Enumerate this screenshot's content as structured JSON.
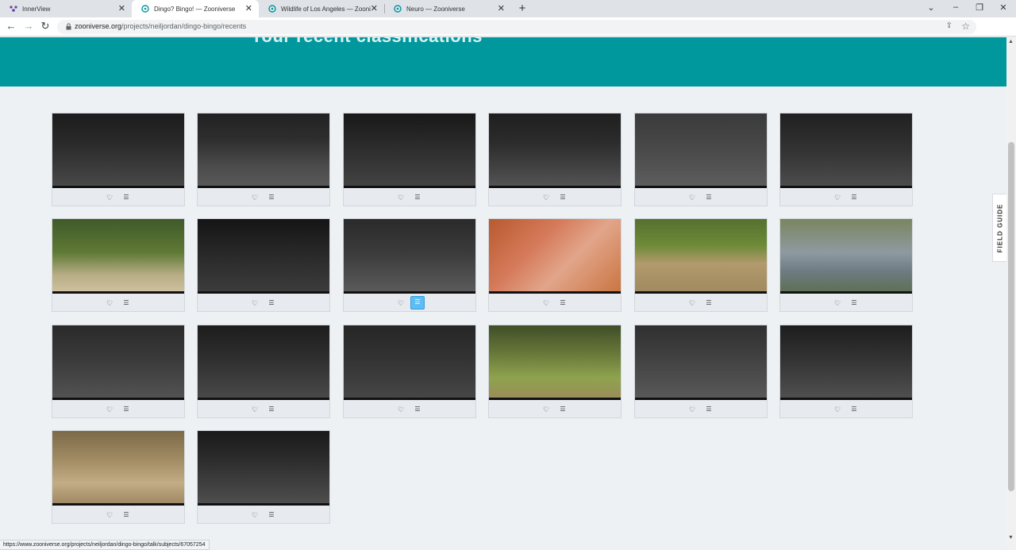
{
  "browser": {
    "tabs": [
      {
        "label": "InnerView",
        "active": false
      },
      {
        "label": "Dingo? Bingo! — Zooniverse",
        "active": true
      },
      {
        "label": "Wildlife of Los Angeles — Zooni",
        "active": false
      },
      {
        "label": "Neuro — Zooniverse",
        "active": false
      }
    ],
    "url_domain": "zooniverse.org",
    "url_path": "/projects/neiljordan/dingo-bingo/recents",
    "status_url": "https://www.zooniverse.org/projects/neiljordan/dingo-bingo/talk/subjects/67057254"
  },
  "page": {
    "title": "Your recent classifications",
    "field_guide": "FIELD GUIDE"
  },
  "colors": {
    "hero": "#00979d",
    "page_bg": "#eef1f4",
    "collect_active": "#5ebdf2"
  },
  "subjects": [
    {
      "scene": "night-foliage",
      "collect_active": false
    },
    {
      "scene": "night-forest-trunk",
      "collect_active": false
    },
    {
      "scene": "night-road",
      "collect_active": false
    },
    {
      "scene": "night-forest",
      "collect_active": false
    },
    {
      "scene": "night-open",
      "collect_active": false
    },
    {
      "scene": "night-dark",
      "collect_active": false
    },
    {
      "scene": "day-forest",
      "collect_active": false
    },
    {
      "scene": "night-track",
      "collect_active": false
    },
    {
      "scene": "night-horse",
      "collect_active": true
    },
    {
      "scene": "red-ground",
      "collect_active": false
    },
    {
      "scene": "day-clearing",
      "collect_active": false
    },
    {
      "scene": "day-shade",
      "collect_active": false
    },
    {
      "scene": "night-animal",
      "collect_active": false
    },
    {
      "scene": "night-animal-2",
      "collect_active": false
    },
    {
      "scene": "night-road-2",
      "collect_active": false
    },
    {
      "scene": "day-green",
      "collect_active": false
    },
    {
      "scene": "night-open-2",
      "collect_active": false
    },
    {
      "scene": "night-animal-3",
      "collect_active": false
    },
    {
      "scene": "day-horse",
      "collect_active": false
    },
    {
      "scene": "night-dingo",
      "collect_active": false
    }
  ]
}
